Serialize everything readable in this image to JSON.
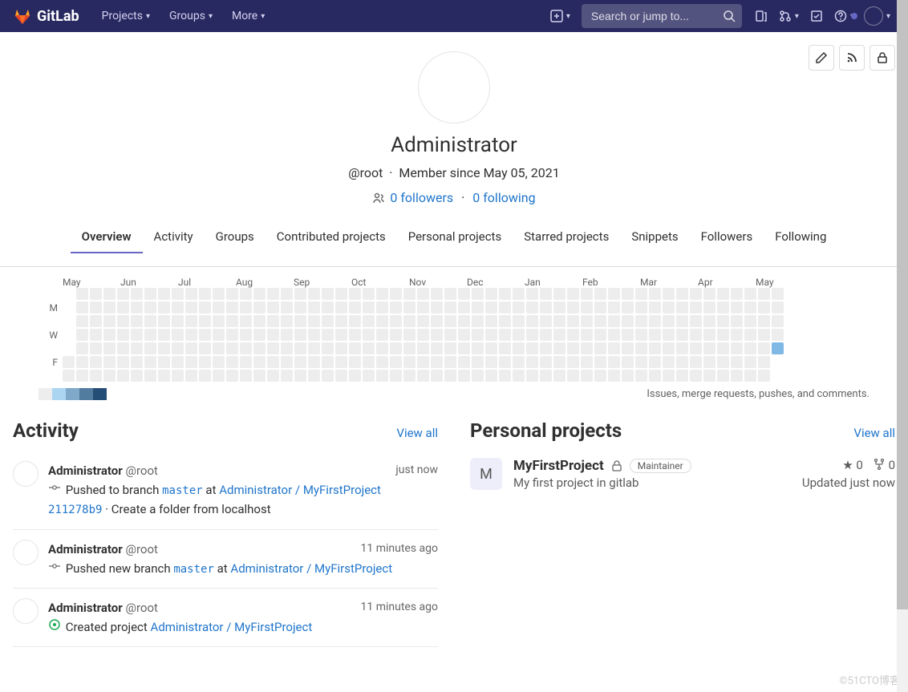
{
  "nav": {
    "brand": "GitLab",
    "items": [
      "Projects",
      "Groups",
      "More"
    ],
    "search_placeholder": "Search or jump to..."
  },
  "profile": {
    "name": "Administrator",
    "handle": "@root",
    "member_since": "Member since May 05, 2021",
    "followers": "0 followers",
    "following": "0 following",
    "tabs": [
      "Overview",
      "Activity",
      "Groups",
      "Contributed projects",
      "Personal projects",
      "Starred projects",
      "Snippets",
      "Followers",
      "Following"
    ]
  },
  "calendar": {
    "months": [
      "May",
      "Jun",
      "Jul",
      "Aug",
      "Sep",
      "Oct",
      "Nov",
      "Dec",
      "Jan",
      "Feb",
      "Mar",
      "Apr",
      "May"
    ],
    "day_labels": [
      "M",
      "W",
      "F"
    ],
    "legend_caption": "Issues, merge requests, pushes, and comments.",
    "legend_colors": [
      "#ededed",
      "#acd5f2",
      "#7fa8c9",
      "#527ba0",
      "#254e77"
    ]
  },
  "activity": {
    "title": "Activity",
    "view_all": "View all",
    "items": [
      {
        "user": "Administrator",
        "handle": "@root",
        "time": "just now",
        "icon": "commit",
        "prefix": "Pushed to branch ",
        "branch": "master",
        "mid": " at ",
        "project": "Administrator / MyFirstProject",
        "line2_code": "211278b9",
        "line2_text": " · Create a folder from localhost"
      },
      {
        "user": "Administrator",
        "handle": "@root",
        "time": "11 minutes ago",
        "icon": "commit",
        "prefix": "Pushed new branch ",
        "branch": "master",
        "mid": " at ",
        "project": "Administrator / MyFirstProject"
      },
      {
        "user": "Administrator",
        "handle": "@root",
        "time": "11 minutes ago",
        "icon": "created",
        "prefix": "Created project ",
        "project": "Administrator / MyFirstProject"
      }
    ]
  },
  "projects": {
    "title": "Personal projects",
    "view_all": "View all",
    "items": [
      {
        "letter": "M",
        "name": "MyFirstProject",
        "role": "Maintainer",
        "desc": "My first project in gitlab",
        "stars": "0",
        "forks": "0",
        "updated": "Updated just now"
      }
    ]
  },
  "watermark": "©51CTO博客"
}
